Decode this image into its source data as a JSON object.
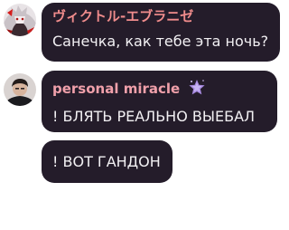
{
  "colors": {
    "bubble_bg": "#241c2a",
    "name_primary": "#f08c8c",
    "name_secondary": "#f0a0aa",
    "message_text": "#f2f0f3",
    "badge": "#a88ae0"
  },
  "messages": [
    {
      "author": "ヴィクトル-エブラニゼ",
      "text": "Санечка, как тебе эта ночь?",
      "avatar_icon": "anime-avatar-icon"
    },
    {
      "author": "personal miracle",
      "text": "! БЛЯТЬ РЕАЛЬНО ВЫЕБАЛ",
      "avatar_icon": "photo-avatar-icon",
      "badge_icon": "sparkle-star-icon"
    },
    {
      "text": "! ВОТ ГАНДОН"
    }
  ]
}
